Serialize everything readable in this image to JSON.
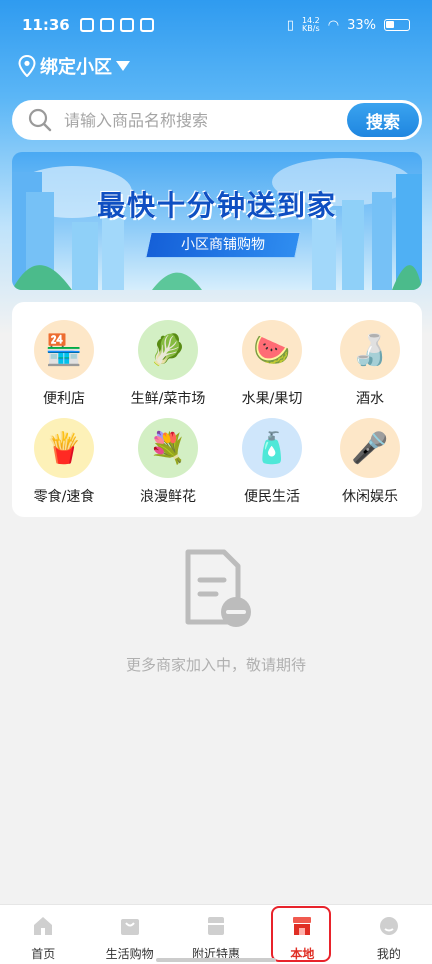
{
  "status_bar": {
    "time": "11:36",
    "net_speed_value": "14.2",
    "net_speed_unit": "KB/s",
    "battery": "33%"
  },
  "location": {
    "label": "绑定小区",
    "icon": "location-pin-icon"
  },
  "search": {
    "placeholder": "请输入商品名称搜索",
    "button_label": "搜索"
  },
  "banner": {
    "title": "最快十分钟送到家",
    "subtitle": "小区商铺购物"
  },
  "categories": [
    {
      "label": "便利店",
      "icon": "convenience-store-icon"
    },
    {
      "label": "生鲜/菜市场",
      "icon": "fresh-vegetables-icon"
    },
    {
      "label": "水果/果切",
      "icon": "fruit-platter-icon"
    },
    {
      "label": "酒水",
      "icon": "liquor-icon"
    },
    {
      "label": "零食/速食",
      "icon": "snacks-icon"
    },
    {
      "label": "浪漫鲜花",
      "icon": "flower-bouquet-icon"
    },
    {
      "label": "便民生活",
      "icon": "detergent-icon"
    },
    {
      "label": "休闲娱乐",
      "icon": "microphone-icon"
    }
  ],
  "empty_state": {
    "text": "更多商家加入中，敬请期待",
    "icon": "document-remove-icon"
  },
  "bottom_nav": [
    {
      "label": "首页",
      "icon": "home-icon",
      "active": false
    },
    {
      "label": "生活购物",
      "icon": "shopping-bag-icon",
      "active": false
    },
    {
      "label": "附近特惠",
      "icon": "coupon-icon",
      "active": false
    },
    {
      "label": "本地",
      "icon": "local-store-icon",
      "active": true
    },
    {
      "label": "我的",
      "icon": "profile-icon",
      "active": false
    }
  ],
  "colors": {
    "primary_blue": "#2f9bf0",
    "active_red": "#e02e24"
  }
}
